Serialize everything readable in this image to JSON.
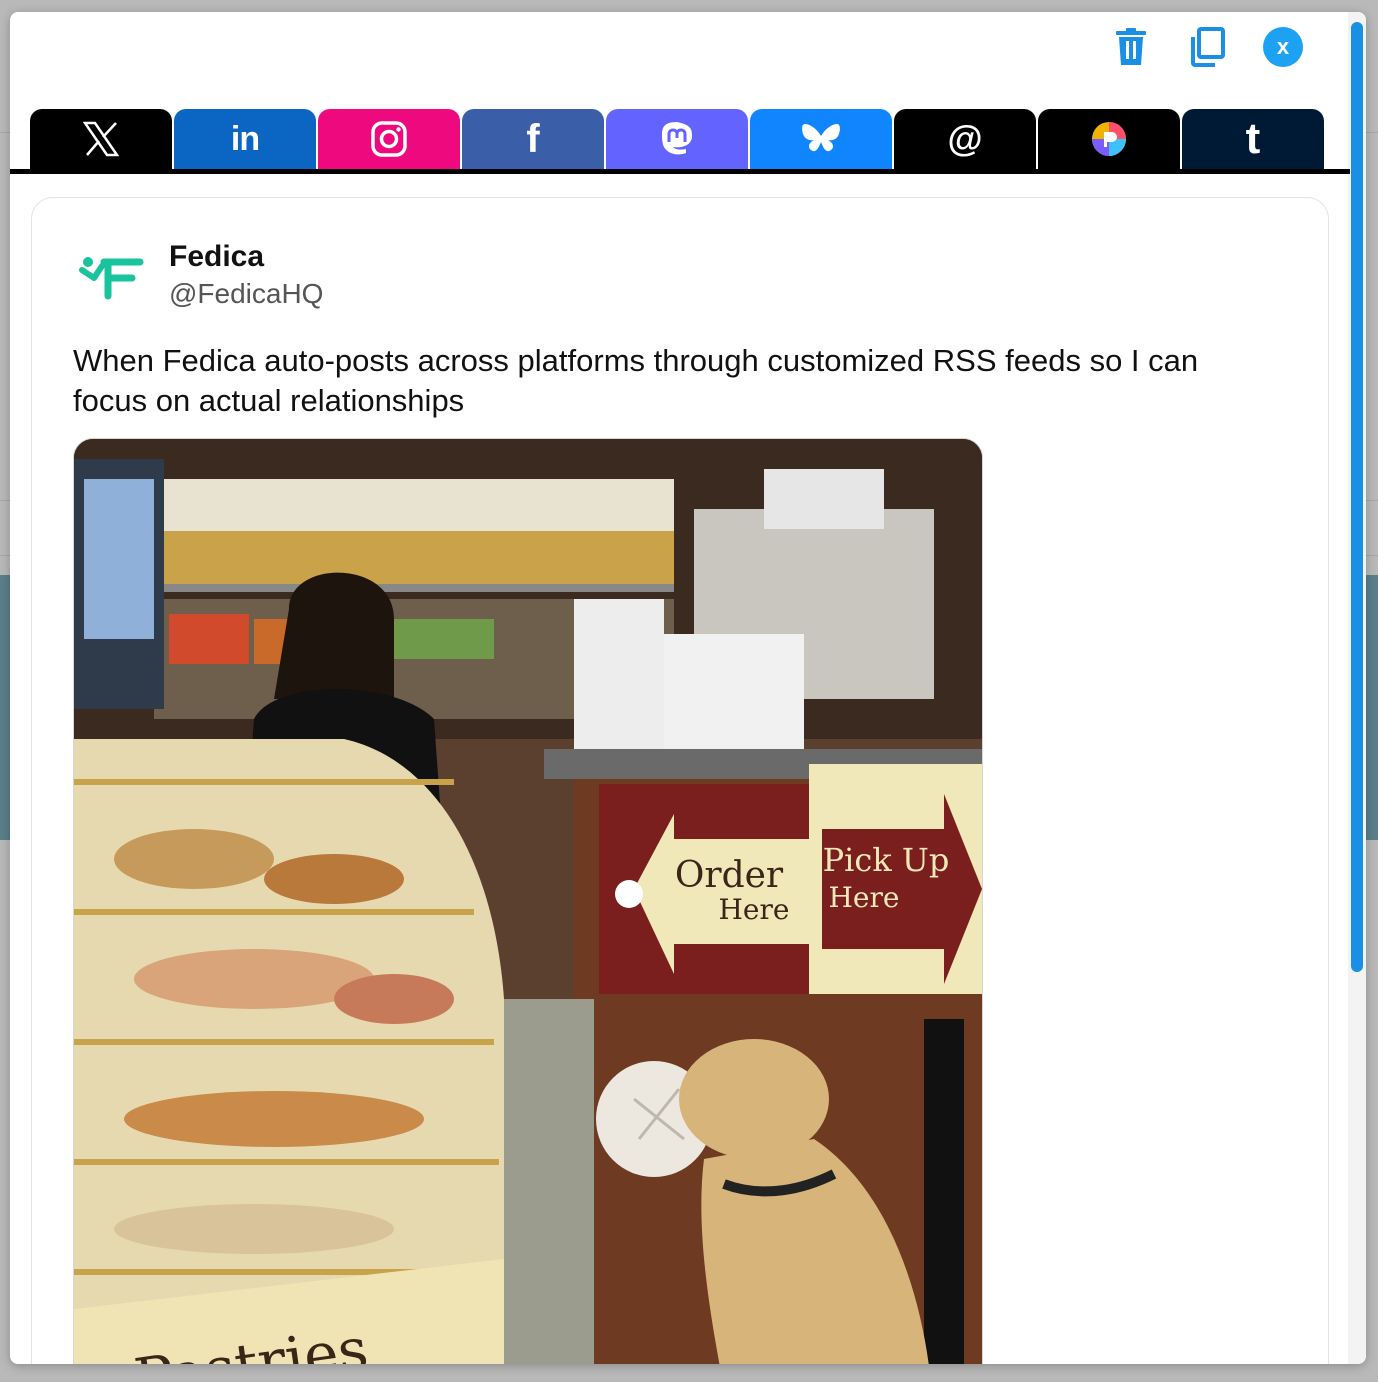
{
  "toolbar": {
    "icons": [
      "trash-icon",
      "copy-icon",
      "close-icon"
    ],
    "close_label": "x"
  },
  "tabs": [
    {
      "name": "X",
      "icon": "x-logo-icon",
      "color": "#000000"
    },
    {
      "name": "LinkedIn",
      "icon": "linkedin-icon",
      "label": "in",
      "color": "#0a66c2"
    },
    {
      "name": "Instagram",
      "icon": "instagram-icon",
      "color": "#ee0a7e"
    },
    {
      "name": "Facebook",
      "icon": "facebook-icon",
      "label": "f",
      "color": "#3b5ea9"
    },
    {
      "name": "Mastodon",
      "icon": "mastodon-icon",
      "color": "#6364ff"
    },
    {
      "name": "Bluesky",
      "icon": "bluesky-icon",
      "color": "#1185fe"
    },
    {
      "name": "Threads",
      "icon": "threads-icon",
      "label": "@",
      "color": "#000000"
    },
    {
      "name": "Pixelfed",
      "icon": "pixelfed-icon",
      "color": "#000000"
    },
    {
      "name": "Tumblr",
      "icon": "tumblr-icon",
      "label": "t",
      "color": "#001935"
    }
  ],
  "post": {
    "display_name": "Fedica",
    "handle": "@FedicaHQ",
    "text": "When Fedica auto-posts across platforms through customized RSS feeds so I can focus on actual relationships",
    "avatar_color": "#19c39c",
    "image": {
      "sign_order_line1": "Order",
      "sign_order_line2": "Here",
      "sign_pickup_line1": "Pick Up",
      "sign_pickup_line2": "Here",
      "case_label": "Pastries"
    }
  },
  "colors": {
    "accent": "#1a8fe3",
    "close": "#1da1f2"
  }
}
